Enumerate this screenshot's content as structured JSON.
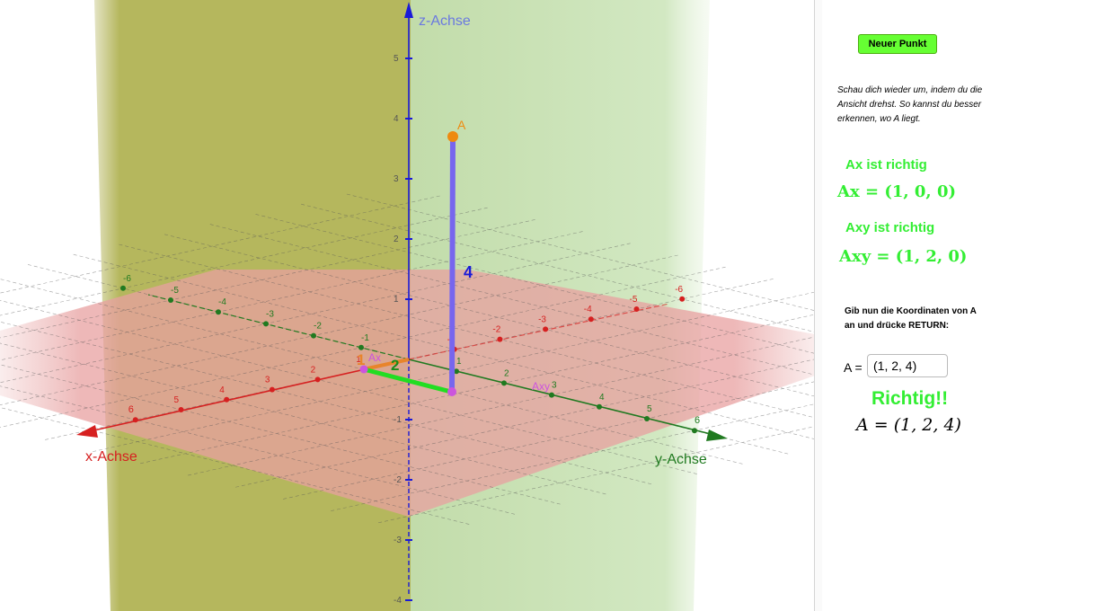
{
  "graphics": {
    "axes": {
      "x_label": "x-Achse",
      "y_label": "y-Achse",
      "z_label": "z-Achse",
      "x_ticks": [
        "-6",
        "-5",
        "-4",
        "-3",
        "-2",
        "-1",
        "1",
        "2",
        "3",
        "4",
        "5",
        "6"
      ],
      "y_ticks": [
        "-6",
        "-5",
        "-4",
        "-3",
        "-2",
        "-1",
        "1",
        "2",
        "3",
        "4",
        "5",
        "6"
      ],
      "z_ticks": [
        "5",
        "4",
        "3",
        "2",
        "1",
        "-1",
        "-2",
        "-3",
        "-4"
      ]
    },
    "point_labels": {
      "a": "A",
      "ax": "Ax",
      "axy": "Axy"
    },
    "segment_labels": {
      "x": "1",
      "y": "2",
      "z": "4"
    },
    "colors": {
      "x_axis": "#d62020",
      "y_axis": "#207a20",
      "z_axis": "#1a1ad8",
      "point_a": "#ee8a10",
      "point_helper": "#cc55dd",
      "segment_y": "#22dd22",
      "segment_z": "#7766ee"
    }
  },
  "panel": {
    "new_point_button": "Neuer Punkt",
    "hint_text": "Schau dich wieder um, indem du die Ansicht drehst. So kannst du besser erkennen, wo A liegt.",
    "ax_status": "Ax ist richtig",
    "ax_formula": "Ax = (1, 0, 0)",
    "axy_status": "Axy ist richtig",
    "axy_formula": "Axy = (1, 2, 0)",
    "prompt_text": "Gib nun die Koordinaten von A an und drücke RETURN:",
    "input_label": "A =",
    "input_value": "(1, 2, 4)",
    "result_text": "Richtig!!",
    "result_formula": "A = (1, 2, 4)"
  }
}
